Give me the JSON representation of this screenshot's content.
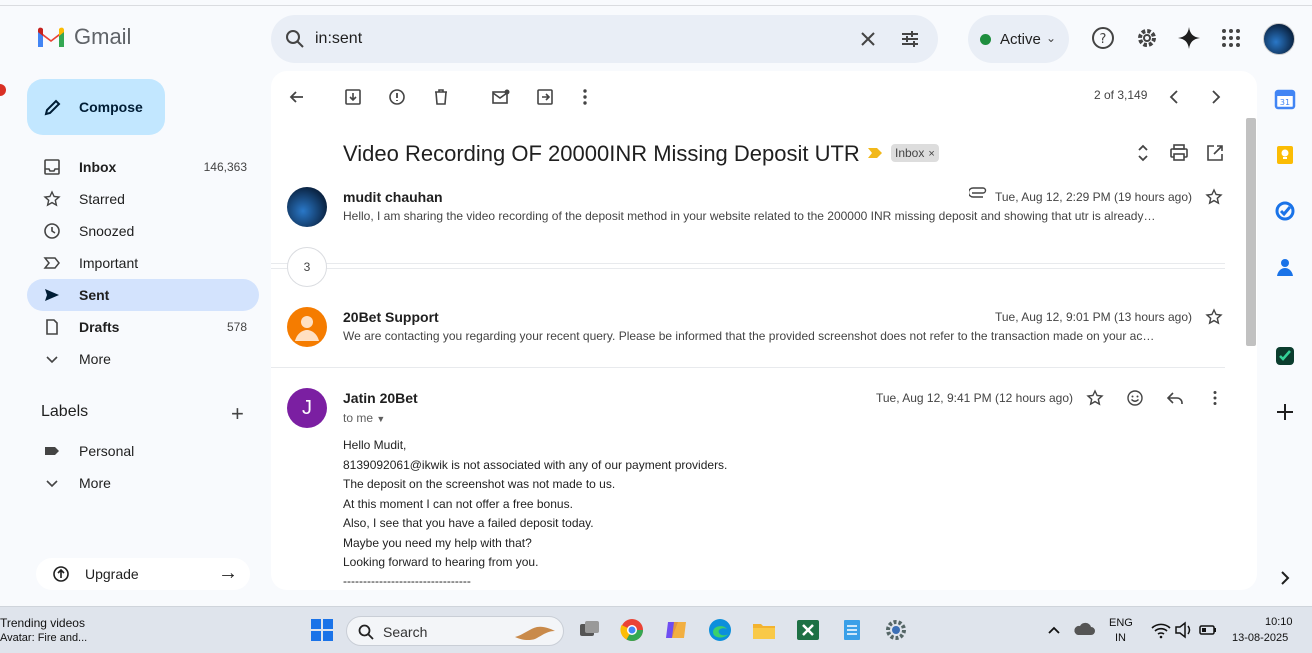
{
  "app": {
    "name": "Gmail"
  },
  "search": {
    "query": "in:sent"
  },
  "status": {
    "label": "Active"
  },
  "sidebar": {
    "compose_label": "Compose",
    "items": [
      {
        "label": "Inbox",
        "count": "146,363"
      },
      {
        "label": "Starred",
        "count": ""
      },
      {
        "label": "Snoozed",
        "count": ""
      },
      {
        "label": "Important",
        "count": ""
      },
      {
        "label": "Sent",
        "count": ""
      },
      {
        "label": "Drafts",
        "count": "578"
      },
      {
        "label": "More",
        "count": ""
      }
    ],
    "labels_heading": "Labels",
    "labels": [
      {
        "label": "Personal"
      },
      {
        "label": "More"
      }
    ],
    "upgrade_label": "Upgrade"
  },
  "toolbar": {
    "pager": "2 of 3,149"
  },
  "thread": {
    "subject": "Video Recording OF 20000INR Missing Deposit UTR",
    "chip": "Inbox",
    "collapsed_count": "3",
    "messages": [
      {
        "sender": "mudit chauhan",
        "date": "Tue, Aug 12, 2:29 PM (19 hours ago)",
        "snippet": "Hello, I am sharing the video recording of the deposit method in your website related to the 200000 INR missing deposit and showing that utr is already…"
      },
      {
        "sender": "20Bet Support",
        "date": "Tue, Aug 12, 9:01 PM (13 hours ago)",
        "snippet": "We are contacting you regarding your recent query. Please be informed that the provided screenshot does not refer to the transaction made on your ac…"
      },
      {
        "sender": "Jatin 20Bet",
        "avatar_letter": "J",
        "date": "Tue, Aug 12, 9:41 PM (12 hours ago)",
        "to": "to me",
        "body": [
          "Hello Mudit,",
          "8139092061@ikwik is not associated with any of our payment providers.",
          "The deposit on the screenshot was not made to us.",
          "At this moment I can not offer a free bonus.",
          "Also, I see that you have a failed deposit today.",
          "Maybe you need my help with that?",
          "Looking forward to hearing from you.",
          "--------------------------------"
        ]
      }
    ]
  },
  "taskbar": {
    "news_title": "Trending videos",
    "news_sub": "Avatar: Fire and...",
    "search_label": "Search",
    "lang": "ENG",
    "region": "IN",
    "time": "10:10",
    "date": "13-08-2025"
  },
  "colors": {
    "accent": "#0b57d0",
    "compose_bg": "#c2e7ff",
    "selected_nav": "#d3e3fd",
    "active_green": "#1e8e3e",
    "avatar_support": "#f57c00",
    "avatar_jatin": "#7b1fa2"
  }
}
